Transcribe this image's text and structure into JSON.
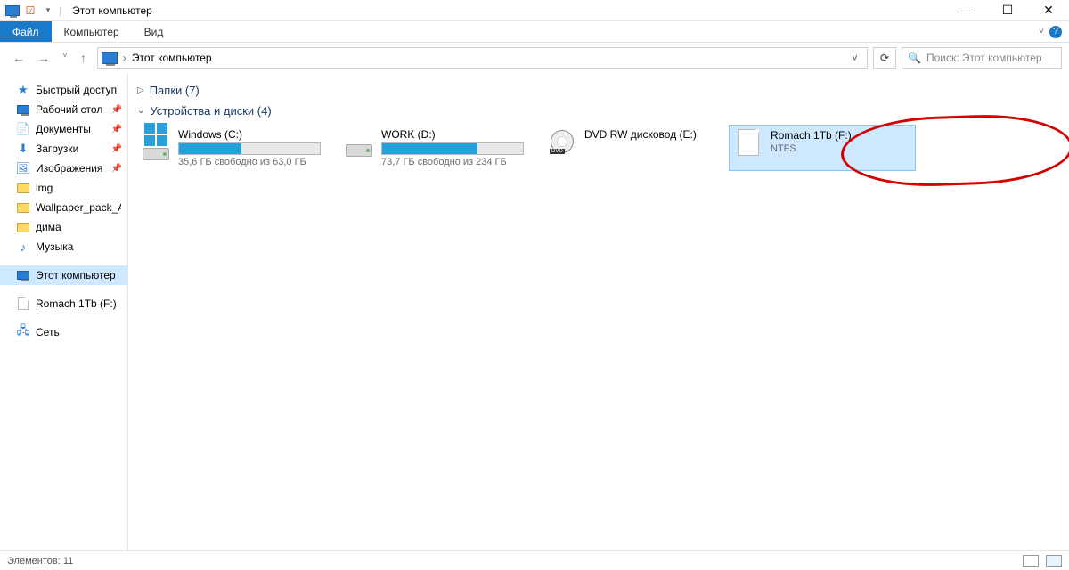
{
  "titlebar": {
    "title": "Этот компьютер"
  },
  "ribbon": {
    "file": "Файл",
    "computer": "Компьютер",
    "view": "Вид"
  },
  "address": {
    "location": "Этот компьютер"
  },
  "search": {
    "placeholder": "Поиск: Этот компьютер"
  },
  "sidebar": {
    "quick_access": "Быстрый доступ",
    "desktop": "Рабочий стол",
    "documents": "Документы",
    "downloads": "Загрузки",
    "pictures": "Изображения",
    "img": "img",
    "wallpaper": "Wallpaper_pack_An",
    "dima": "дима",
    "music": "Музыка",
    "this_pc": "Этот компьютер",
    "romach": "Romach 1Tb (F:)",
    "network": "Сеть"
  },
  "sections": {
    "folders": "Папки (7)",
    "devices": "Устройства и диски (4)"
  },
  "drives": {
    "c": {
      "name": "Windows (C:)",
      "free": "35,6 ГБ свободно из 63,0 ГБ",
      "fill_pct": 44
    },
    "d": {
      "name": "WORK (D:)",
      "free": "73,7 ГБ свободно из 234 ГБ",
      "fill_pct": 68
    },
    "e": {
      "name": "DVD RW дисковод (E:)"
    },
    "f": {
      "name": "Romach 1Tb (F:)",
      "sub": "NTFS"
    }
  },
  "status": {
    "items": "Элементов: 11"
  }
}
